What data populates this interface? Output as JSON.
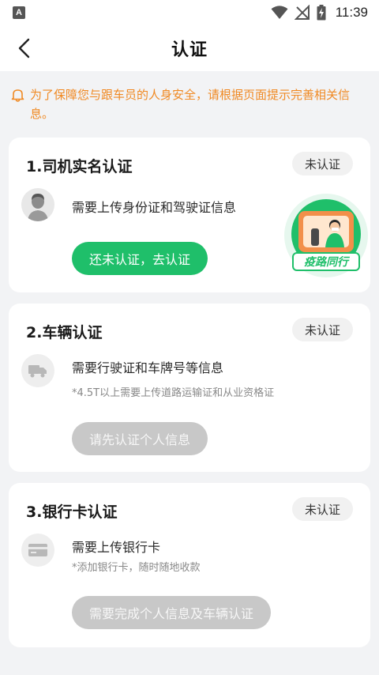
{
  "status_bar": {
    "app_badge": "A",
    "time": "11:39"
  },
  "nav": {
    "title": "认证"
  },
  "notice": {
    "text": "为了保障您与跟车员的人身安全，请根据页面提示完善相关信息。"
  },
  "cards": [
    {
      "title": "1.司机实名认证",
      "status": "未认证",
      "description": "需要上传身份证和驾驶证信息",
      "button": "还未认证，去认证",
      "illustration_label": "疫路同行",
      "accent": "#1fbf6a"
    },
    {
      "title": "2.车辆认证",
      "status": "未认证",
      "description": "需要行驶证和车牌号等信息",
      "note": "*4.5T以上需要上传道路运输证和从业资格证",
      "button": "请先认证个人信息"
    },
    {
      "title": "3.银行卡认证",
      "status": "未认证",
      "description": "需要上传银行卡",
      "note": "*添加银行卡，随时随地收款",
      "button": "需要完成个人信息及车辆认证"
    }
  ],
  "colors": {
    "background": "#f2f3f5",
    "notice": "#f08a24",
    "primary_green": "#1fbf6a",
    "disabled_gray": "#c8c8c8"
  },
  "icons": [
    "wifi-icon",
    "no-signal-icon",
    "battery-charging-icon",
    "back-arrow-icon",
    "bell-icon",
    "avatar-icon",
    "truck-icon",
    "bank-card-icon"
  ]
}
